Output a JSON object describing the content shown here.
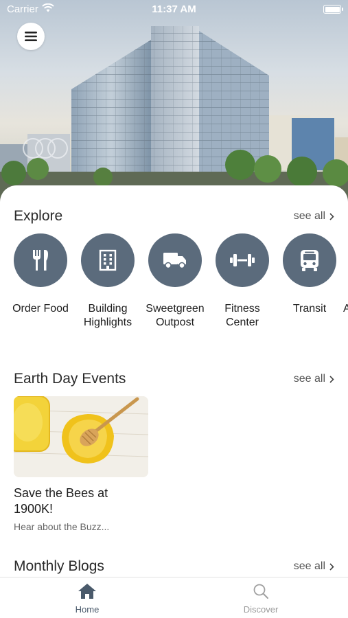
{
  "status_bar": {
    "carrier": "Carrier",
    "time": "11:37 AM"
  },
  "explore": {
    "title": "Explore",
    "see_all": "see all",
    "items": [
      {
        "label": "Order Food",
        "icon": "fork-knife-icon"
      },
      {
        "label": "Building\nHighlights",
        "icon": "building-icon"
      },
      {
        "label": "Sweetgreen\nOutpost",
        "icon": "truck-icon"
      },
      {
        "label": "Fitness\nCenter",
        "icon": "dumbbell-icon"
      },
      {
        "label": "Transit",
        "icon": "bus-icon"
      },
      {
        "label": "A"
      }
    ]
  },
  "events": {
    "title": "Earth Day Events",
    "see_all": "see all",
    "cards": [
      {
        "title": "Save the Bees at 1900K!",
        "subtitle": "Hear about the Buzz..."
      }
    ]
  },
  "blogs": {
    "title": "Monthly Blogs",
    "see_all": "see all"
  },
  "tabbar": {
    "home": {
      "label": "Home",
      "icon": "home-icon",
      "active": true
    },
    "discover": {
      "label": "Discover",
      "icon": "search-icon",
      "active": false
    }
  },
  "colors": {
    "accent_circle": "#5b6b7c",
    "active_tab": "#4a5a6b",
    "inactive_tab": "#9a9a9a"
  }
}
